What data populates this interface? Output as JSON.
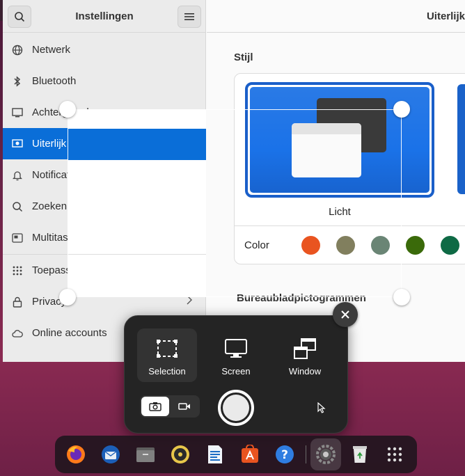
{
  "settings": {
    "sidebar_title": "Instellingen",
    "content_title": "Uiterlijk",
    "nav": [
      {
        "label": "Netwerk",
        "icon": "network-icon"
      },
      {
        "label": "Bluetooth",
        "icon": "bluetooth-icon"
      },
      {
        "label": "Achtergrond",
        "icon": "background-icon"
      },
      {
        "label": "Uiterlijk",
        "icon": "appearance-icon"
      },
      {
        "label": "Notificaties",
        "icon": "bell-icon"
      },
      {
        "label": "Zoeken",
        "icon": "search-icon"
      },
      {
        "label": "Multitasken",
        "icon": "multitasking-icon"
      },
      {
        "label": "Toepassingen",
        "icon": "apps-icon"
      },
      {
        "label": "Privacy",
        "icon": "lock-icon"
      },
      {
        "label": "Online accounts",
        "icon": "cloud-icon"
      }
    ],
    "style_label": "Stijl",
    "theme_light_label": "Licht",
    "color_label": "Color",
    "accent_colors": [
      "#e95420",
      "#817f5e",
      "#6a8575",
      "#3a6a0a",
      "#0e6a45"
    ],
    "desktop_icons_label": "Bureaubladpictogrammen"
  },
  "screenshot_tool": {
    "modes": [
      {
        "label": "Selection",
        "icon": "selection-icon",
        "active": true
      },
      {
        "label": "Screen",
        "icon": "screen-icon",
        "active": false
      },
      {
        "label": "Window",
        "icon": "window-icon",
        "active": false
      }
    ]
  },
  "dock": {
    "apps": [
      "firefox-icon",
      "thunderbird-icon",
      "files-icon",
      "rhythmbox-icon",
      "writer-icon",
      "app-center-icon",
      "help-icon",
      "settings-icon",
      "trash-icon",
      "show-apps-icon"
    ]
  }
}
